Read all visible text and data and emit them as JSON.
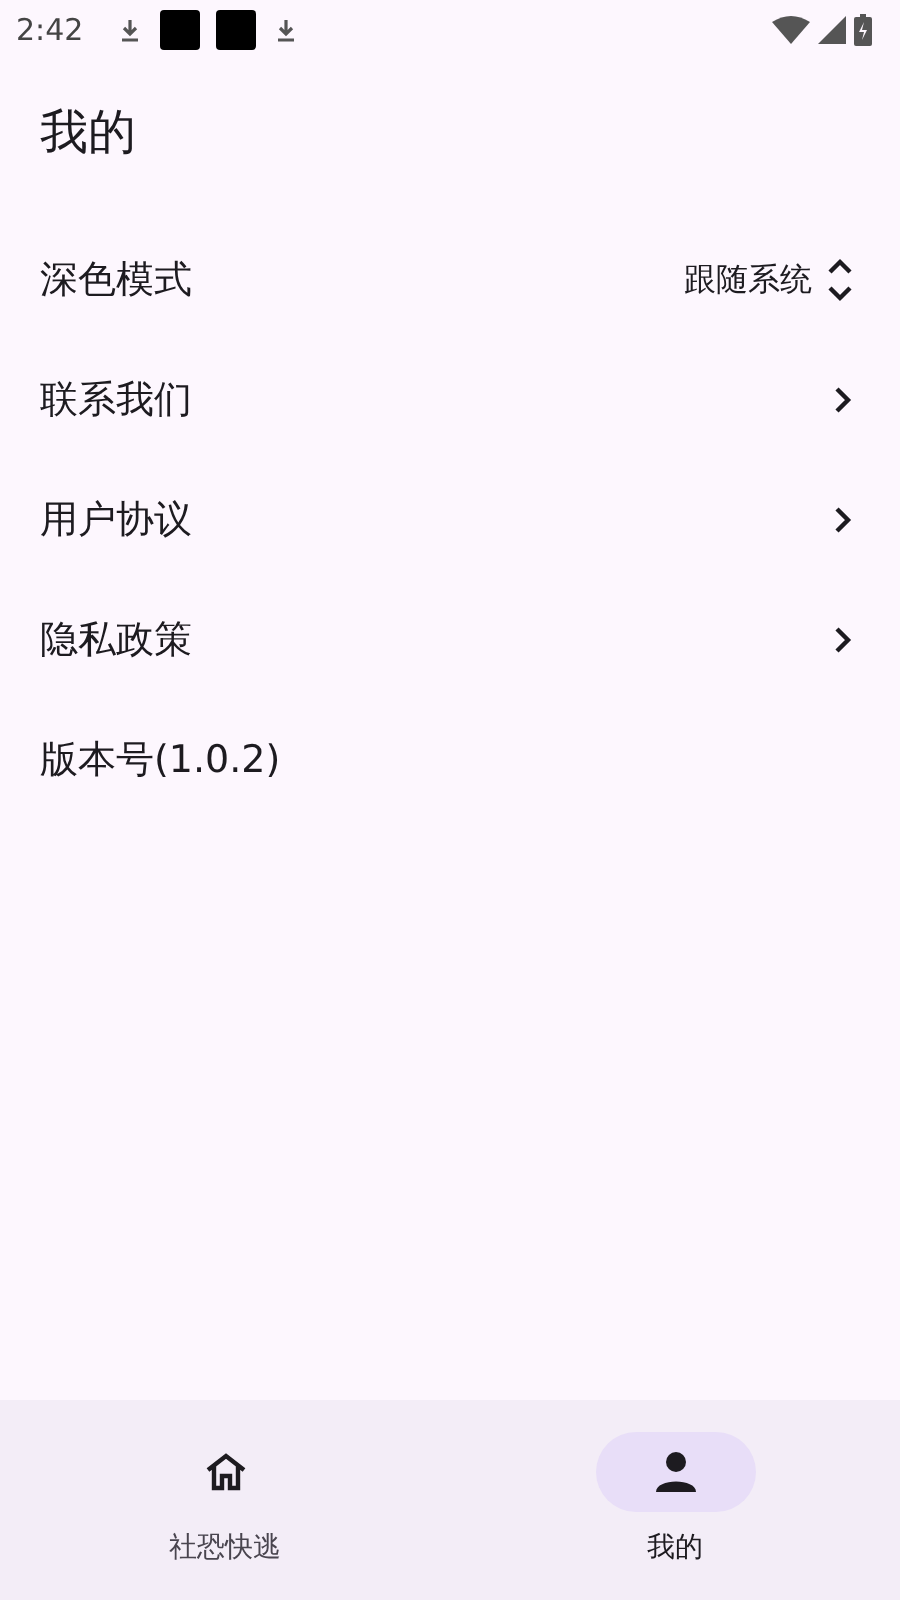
{
  "status_bar": {
    "time": "2:42"
  },
  "title": "我的",
  "settings": [
    {
      "kind": "select",
      "label": "深色模式",
      "value": "跟随系统"
    },
    {
      "kind": "link",
      "label": "联系我们"
    },
    {
      "kind": "link",
      "label": "用户协议"
    },
    {
      "kind": "link",
      "label": "隐私政策"
    },
    {
      "kind": "text",
      "label": "版本号(1.0.2)"
    }
  ],
  "nav": [
    {
      "kind": "home",
      "label": "社恐快逃",
      "selected": false
    },
    {
      "kind": "person",
      "label": "我的",
      "selected": true
    }
  ]
}
